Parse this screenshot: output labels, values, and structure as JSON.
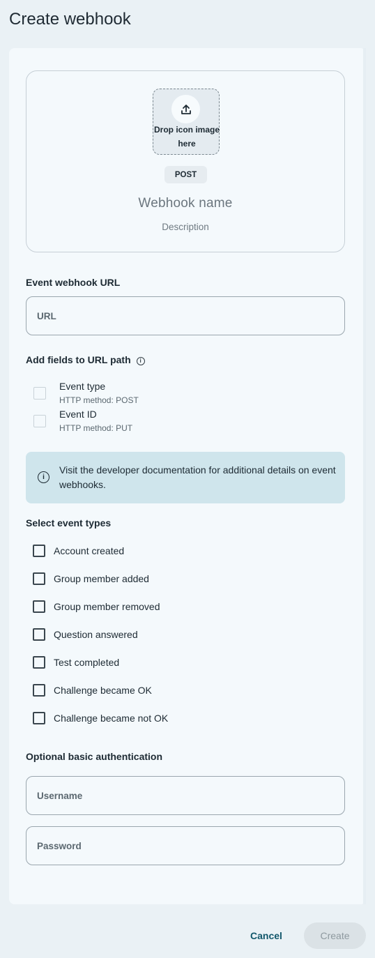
{
  "page": {
    "title": "Create webhook"
  },
  "hero": {
    "drop_text": "Drop icon image here",
    "method": "POST",
    "name_placeholder": "Webhook name",
    "description_placeholder": "Description"
  },
  "url_section": {
    "label": "Event webhook URL",
    "placeholder": "URL"
  },
  "path_section": {
    "label": "Add fields to URL path",
    "fields": [
      {
        "title": "Event type",
        "subtitle": "HTTP method: POST",
        "checked": false,
        "disabled": true
      },
      {
        "title": "Event ID",
        "subtitle": "HTTP method: PUT",
        "checked": false,
        "disabled": true
      }
    ]
  },
  "info_banner": {
    "text": "Visit the developer documentation for additional details on event webhooks."
  },
  "events_section": {
    "label": "Select event types",
    "events": [
      {
        "label": "Account created",
        "checked": false
      },
      {
        "label": "Group member added",
        "checked": false
      },
      {
        "label": "Group member removed",
        "checked": false
      },
      {
        "label": "Question answered",
        "checked": false
      },
      {
        "label": "Test completed",
        "checked": false
      },
      {
        "label": "Challenge became OK",
        "checked": false
      },
      {
        "label": "Challenge became not OK",
        "checked": false
      }
    ]
  },
  "auth_section": {
    "label": "Optional basic authentication",
    "username_placeholder": "Username",
    "password_placeholder": "Password"
  },
  "footer": {
    "cancel_label": "Cancel",
    "create_label": "Create"
  }
}
